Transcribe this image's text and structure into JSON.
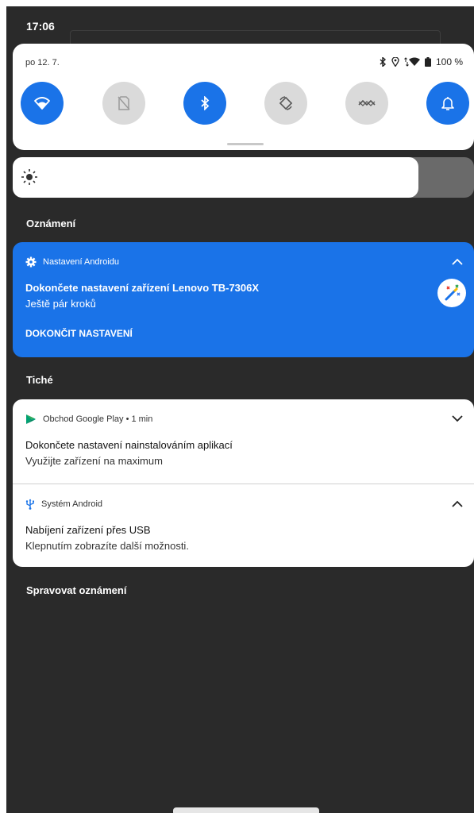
{
  "status_bar": {
    "time": "17:06"
  },
  "quick_settings": {
    "date": "po 12. 7.",
    "battery": "100 %",
    "tiles": [
      {
        "icon": "wifi-icon",
        "state": "on"
      },
      {
        "icon": "no-sim-icon",
        "state": "off"
      },
      {
        "icon": "bluetooth-icon",
        "state": "on"
      },
      {
        "icon": "auto-rotate-icon",
        "state": "off"
      },
      {
        "icon": "data-saver-icon",
        "state": "off"
      },
      {
        "icon": "notification-bell-icon",
        "state": "on"
      }
    ]
  },
  "brightness": {
    "level": 0.88
  },
  "sections": {
    "notifications": "Oznámení",
    "silent": "Tiché",
    "manage": "Spravovat oznámení"
  },
  "notifications": {
    "android_setup": {
      "app": "Nastavení Androidu",
      "title": "Dokončete nastavení zařízení Lenovo TB-7306X",
      "text": "Ještě pár kroků",
      "action": "DOKONČIT NASTAVENÍ"
    },
    "play_store": {
      "app": "Obchod Google Play • 1 min",
      "title": "Dokončete nastavení nainstalováním aplikací",
      "text": "Využijte zařízení na maximum"
    },
    "android_system": {
      "app": "Systém Android",
      "title": "Nabíjení zařízení přes USB",
      "text": "Klepnutím zobrazíte další možnosti."
    }
  },
  "colors": {
    "accent": "#1a73e8",
    "background": "#2a2a2a",
    "tile_off": "#dadada"
  }
}
